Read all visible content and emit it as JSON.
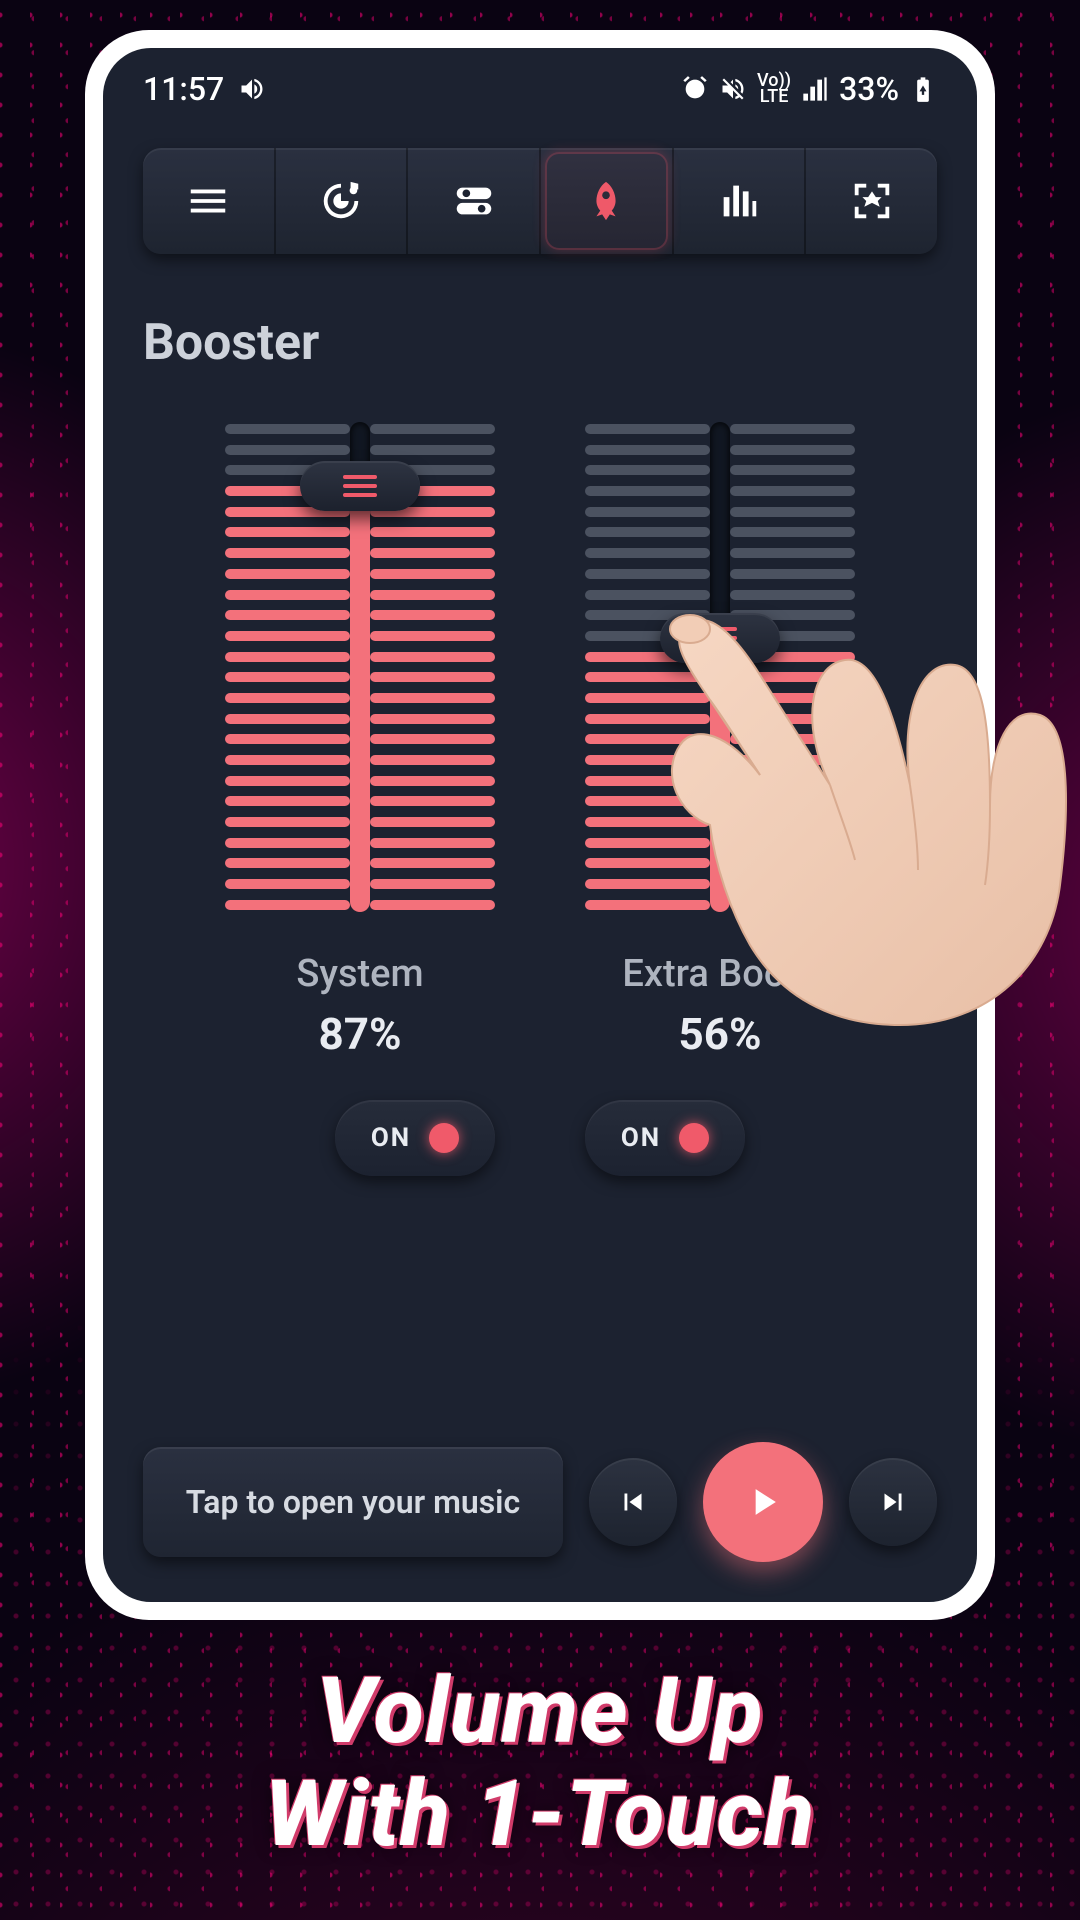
{
  "status": {
    "time": "11:57",
    "battery": "33%",
    "network_label": "Vo))\nLTE"
  },
  "nav": {
    "items": [
      {
        "name": "menu"
      },
      {
        "name": "music"
      },
      {
        "name": "settings"
      },
      {
        "name": "booster",
        "active": true
      },
      {
        "name": "equalizer"
      },
      {
        "name": "scan"
      }
    ]
  },
  "section_title": "Booster",
  "sliders": {
    "system": {
      "label": "System",
      "value_text": "87%",
      "value": 87,
      "toggle": "ON"
    },
    "extra": {
      "label": "Extra Boost",
      "value_text": "56%",
      "value": 56,
      "toggle": "ON"
    }
  },
  "player": {
    "open_music": "Tap to open your music"
  },
  "caption": {
    "line1": "Volume Up",
    "line2": "With 1-Touch"
  },
  "colors": {
    "accent": "#f3717b",
    "accent_strong": "#f05a6a",
    "panel": "#1c2230"
  }
}
